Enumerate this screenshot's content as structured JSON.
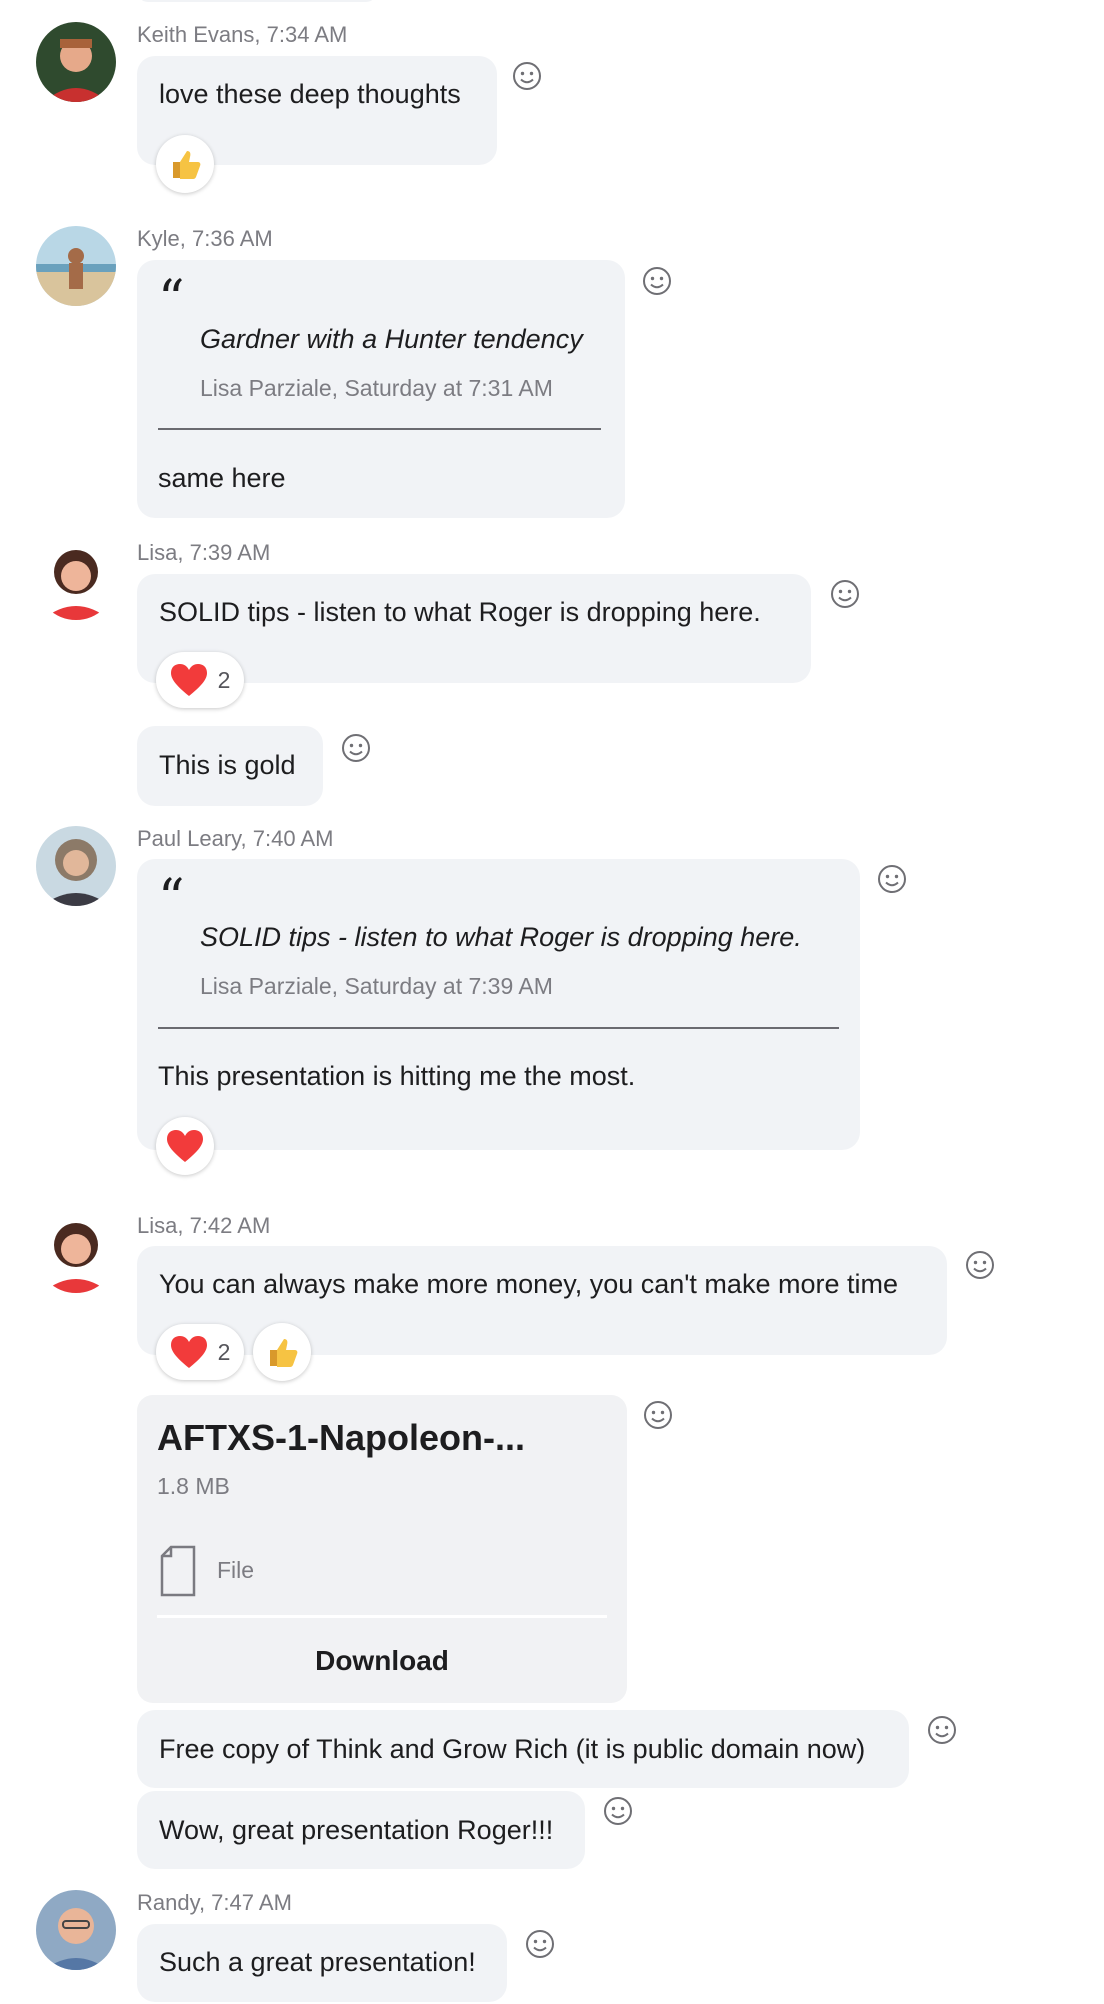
{
  "messages": [
    {
      "sender": "Keith Evans, 7:34 AM",
      "text": "love these deep thoughts"
    },
    {
      "sender": "Kyle, 7:36 AM",
      "quote": {
        "text": "Gardner with a Hunter tendency",
        "source": "Lisa Parziale, Saturday at 7:31 AM"
      },
      "text": "same here"
    },
    {
      "sender": "Lisa, 7:39 AM",
      "text": "SOLID tips - listen to what Roger is dropping here.",
      "heart_count": "2"
    },
    {
      "text": "This is gold"
    },
    {
      "sender": "Paul Leary, 7:40 AM",
      "quote": {
        "text": "SOLID tips - listen to what Roger is dropping here.",
        "source": "Lisa Parziale, Saturday at 7:39 AM"
      },
      "text": "This presentation is hitting me the most."
    },
    {
      "sender": "Lisa, 7:42 AM",
      "text": "You can always make more money, you can't make more time",
      "heart_count": "2"
    },
    {
      "file": {
        "name": "AFTXS-1-Napoleon-...",
        "size": "1.8 MB",
        "type": "File",
        "action": "Download"
      }
    },
    {
      "text": "Free copy of Think and Grow Rich (it is public domain now)"
    },
    {
      "text": "Wow, great presentation Roger!!!"
    },
    {
      "sender": "Randy, 7:47 AM",
      "text": "Such a great presentation!"
    }
  ],
  "icons": {
    "heart": "heart-icon",
    "thumbs_up": "thumbs-up-icon",
    "smile": "smiley-icon",
    "file": "file-icon"
  },
  "colors": {
    "bubble": "#f1f3f6",
    "heart": "#f23b3b",
    "thumbs_up": "#f6c343"
  }
}
